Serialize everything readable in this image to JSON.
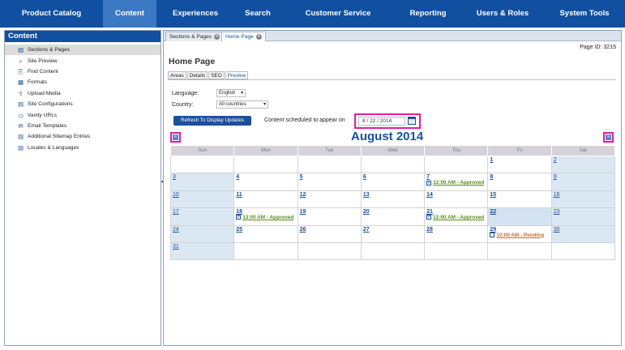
{
  "topnav": {
    "items": [
      {
        "label": "Product Catalog",
        "active": false
      },
      {
        "label": "Content",
        "active": true
      },
      {
        "label": "Experiences",
        "active": false
      },
      {
        "label": "Search",
        "active": false
      },
      {
        "label": "Customer Service",
        "active": false
      },
      {
        "label": "Reporting",
        "active": false
      },
      {
        "label": "Users & Roles",
        "active": false
      },
      {
        "label": "System Tools",
        "active": false
      }
    ]
  },
  "sidebar": {
    "title": "Content",
    "items": [
      {
        "label": "Sections & Pages",
        "icon": "page-icon",
        "active": true
      },
      {
        "label": "Site Preview",
        "icon": "magnifier-icon",
        "active": false
      },
      {
        "label": "Find Content",
        "icon": "find-icon",
        "active": false
      },
      {
        "label": "Formats",
        "icon": "format-icon",
        "active": false
      },
      {
        "label": "Upload Media",
        "icon": "upload-icon",
        "active": false
      },
      {
        "label": "Site Configurations",
        "icon": "config-icon",
        "active": false
      },
      {
        "label": "Vanity URLs",
        "icon": "link-icon",
        "active": false
      },
      {
        "label": "Email Templates",
        "icon": "envelope-icon",
        "active": false
      },
      {
        "label": "Additional Sitemap Entries",
        "icon": "sitemap-icon",
        "active": false
      },
      {
        "label": "Locales & Languages",
        "icon": "globe-icon",
        "active": false
      }
    ]
  },
  "tabs": [
    {
      "label": "Sections & Pages",
      "active": false
    },
    {
      "label": "Home Page",
      "active": true
    }
  ],
  "page": {
    "id_label": "Page ID: 3215",
    "title": "Home Page",
    "subtabs": [
      {
        "label": "Areas",
        "active": false
      },
      {
        "label": "Details",
        "active": false
      },
      {
        "label": "SEO",
        "active": false
      },
      {
        "label": "Preview",
        "active": true
      }
    ]
  },
  "filters": {
    "language_label": "Language:",
    "language_value": "English",
    "country_label": "Country:",
    "country_value": "All countries"
  },
  "refresh_label": "Refresh To Display Updates",
  "schedule": {
    "label": "Content scheduled to appear on",
    "month": "8",
    "day": "22",
    "year": "2014"
  },
  "calendar": {
    "title": "August 2014",
    "prev_glyph": "«",
    "next_glyph": "»",
    "weekdays": [
      "Sun",
      "Mon",
      "Tue",
      "Wed",
      "Thu",
      "Fri",
      "Sat"
    ],
    "weeks": [
      [
        null,
        null,
        null,
        null,
        null,
        {
          "day": "1"
        },
        {
          "day": "2"
        }
      ],
      [
        {
          "day": "3"
        },
        {
          "day": "4"
        },
        {
          "day": "5"
        },
        {
          "day": "6"
        },
        {
          "day": "7",
          "event": "12:00 AM - Approved",
          "status": "approved"
        },
        {
          "day": "8"
        },
        {
          "day": "9"
        }
      ],
      [
        {
          "day": "10"
        },
        {
          "day": "11"
        },
        {
          "day": "12"
        },
        {
          "day": "13"
        },
        {
          "day": "14"
        },
        {
          "day": "15"
        },
        {
          "day": "16"
        }
      ],
      [
        {
          "day": "17"
        },
        {
          "day": "18",
          "event": "12:00 AM - Approved",
          "status": "approved"
        },
        {
          "day": "19"
        },
        {
          "day": "20"
        },
        {
          "day": "21",
          "event": "12:00 AM - Approved",
          "status": "approved"
        },
        {
          "day": "22",
          "today": true
        },
        {
          "day": "23"
        }
      ],
      [
        {
          "day": "24"
        },
        {
          "day": "25"
        },
        {
          "day": "26"
        },
        {
          "day": "27"
        },
        {
          "day": "28"
        },
        {
          "day": "29",
          "event": "12:00 AM - Pending",
          "status": "pending"
        },
        {
          "day": "30"
        }
      ],
      [
        {
          "day": "31"
        },
        null,
        null,
        null,
        null,
        null,
        null
      ]
    ]
  }
}
